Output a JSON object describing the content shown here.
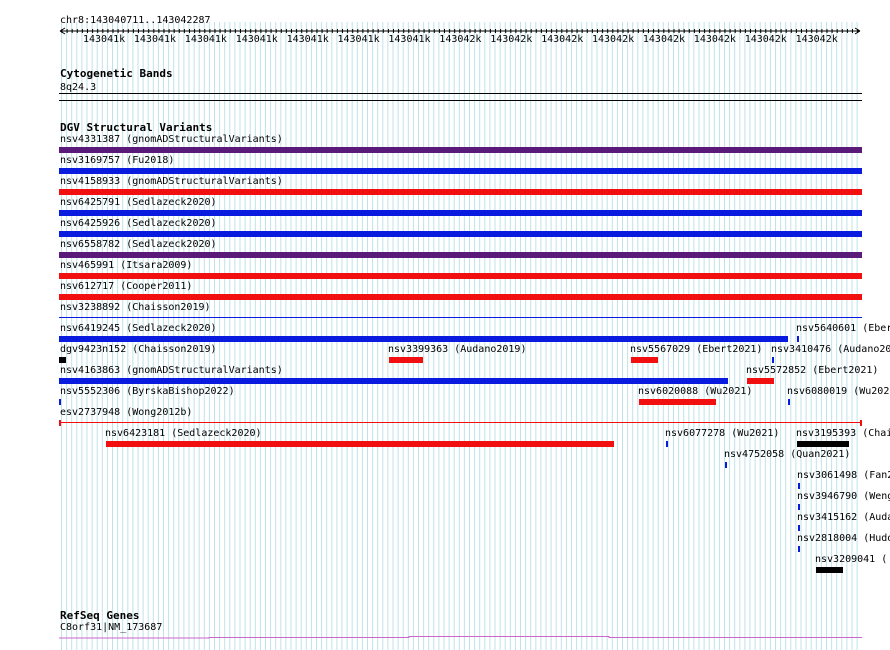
{
  "colors": {
    "grid": "#bfe3ea",
    "purple": "#5a1a7a",
    "blue": "#0a1be0",
    "red": "#f20f0f",
    "black": "#000000",
    "refseq": "#cc66cc"
  },
  "ruler": {
    "location": "chr8:143040711..143042287",
    "ticks": [
      "143041k",
      "143041k",
      "143041k",
      "143041k",
      "143041k",
      "143041k",
      "143041k",
      "143042k",
      "143042k",
      "143042k",
      "143042k",
      "143042k",
      "143042k",
      "143042k",
      "143042k"
    ]
  },
  "tracks": {
    "cytoband": {
      "title": "Cytogenetic Bands",
      "band": "8q24.3"
    },
    "dgv": {
      "title": "DGV Structural Variants",
      "features": [
        {
          "label": "nsv4331387 (gnomADStructuralVariants)",
          "color": "purple"
        },
        {
          "label": "nsv3169757 (Fu2018)",
          "color": "blue"
        },
        {
          "label": "nsv4158933 (gnomADStructuralVariants)",
          "color": "red"
        },
        {
          "label": "nsv6425791 (Sedlazeck2020)",
          "color": "blue"
        },
        {
          "label": "nsv6425926 (Sedlazeck2020)",
          "color": "blue"
        },
        {
          "label": "nsv6558782 (Sedlazeck2020)",
          "color": "purple"
        },
        {
          "label": "nsv465991 (Itsara2009)",
          "color": "red"
        },
        {
          "label": "nsv612717 (Cooper2011)",
          "color": "red"
        },
        {
          "label": "nsv3238892 (Chaisson2019)",
          "color": "blue"
        },
        {
          "label": "nsv6419245 (Sedlazeck2020)",
          "color": "blue"
        },
        {
          "label": "nsv5640601 (Eber",
          "color": "blue"
        },
        {
          "label": "dgv9423n152 (Chaisson2019)",
          "color": "black"
        },
        {
          "label": "nsv3399363 (Audano2019)",
          "color": "red"
        },
        {
          "label": "nsv5567029 (Ebert2021)",
          "color": "red"
        },
        {
          "label": "nsv3410476 (Audano20",
          "color": "blue"
        },
        {
          "label": "nsv4163863 (gnomADStructuralVariants)",
          "color": "blue"
        },
        {
          "label": "nsv5572852 (Ebert2021)",
          "color": "red"
        },
        {
          "label": "nsv5552306 (ByrskaBishop2022)",
          "color": "blue"
        },
        {
          "label": "nsv6020088 (Wu2021)",
          "color": "red"
        },
        {
          "label": "nsv6080019 (Wu202",
          "color": "blue"
        },
        {
          "label": "esv2737948 (Wong2012b)",
          "color": "red"
        },
        {
          "label": "nsv6423181 (Sedlazeck2020)",
          "color": "red"
        },
        {
          "label": "nsv6077278 (Wu2021)",
          "color": "blue"
        },
        {
          "label": "nsv3195393 (Chai",
          "color": "black"
        },
        {
          "label": "nsv4752058 (Quan2021)",
          "color": "blue"
        },
        {
          "label": "nsv3061498 (Fan2",
          "color": "blue"
        },
        {
          "label": "nsv3946790 (Weng",
          "color": "blue"
        },
        {
          "label": "nsv3415162 (Auda",
          "color": "blue"
        },
        {
          "label": "nsv2818004 (Hudo",
          "color": "blue"
        },
        {
          "label": "nsv3209041 (",
          "color": "black"
        }
      ]
    },
    "refseq": {
      "title": "RefSeq Genes",
      "gene": "C8orf31|NM_173687"
    }
  }
}
